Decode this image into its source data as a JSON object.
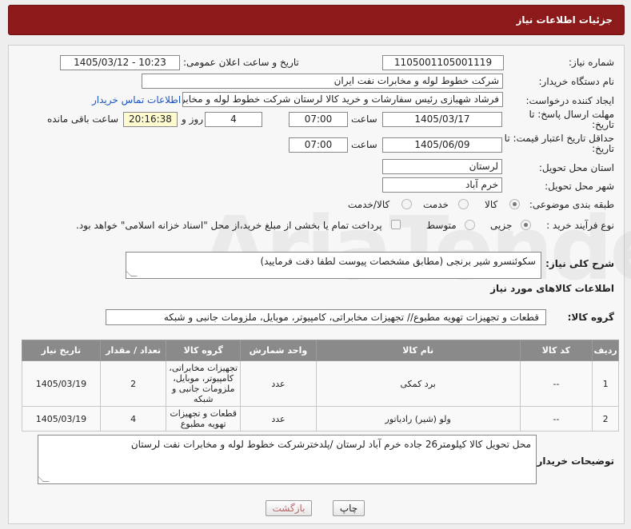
{
  "header": {
    "title": "جزئیات اطلاعات نیاز"
  },
  "form": {
    "need_number": {
      "label": "شماره نیاز:",
      "value": "1105001105001119"
    },
    "announce_datetime": {
      "label": "تاریخ و ساعت اعلان عمومی:",
      "value": "1405/03/12 - 10:23"
    },
    "buyer_org": {
      "label": "نام دستگاه خریدار:",
      "value": "شرکت خطوط لوله و مخابرات نفت ایران"
    },
    "requester": {
      "label": "ایجاد کننده درخواست:",
      "value": "فرشاد شهبازی رئیس سفارشات و خرید کالا لرستان شرکت خطوط لوله و مخابرات",
      "contact_link": "اطلاعات تماس خریدار"
    },
    "reply_deadline": {
      "label": "مهلت ارسال پاسخ: تا تاریخ:",
      "date": "1405/03/17",
      "time_label": "ساعت",
      "time": "07:00",
      "days": "4",
      "days_label": "روز و",
      "remaining": "20:16:38",
      "remaining_label": "ساعت باقی مانده"
    },
    "price_validity": {
      "label": "حداقل تاریخ اعتبار قیمت: تا تاریخ:",
      "date": "1405/06/09",
      "time_label": "ساعت",
      "time": "07:00"
    },
    "province": {
      "label": "استان محل تحویل:",
      "value": "لرستان"
    },
    "city": {
      "label": "شهر محل تحویل:",
      "value": "خرم آباد"
    },
    "category": {
      "label": "طبقه بندی موضوعی:",
      "options": [
        "کالا",
        "خدمت",
        "کالا/خدمت"
      ],
      "selected": "کالا"
    },
    "purchase_type": {
      "label": "نوع فرآیند خرید :",
      "options": [
        "جزیی",
        "متوسط"
      ],
      "selected": "جزیی",
      "payment_note": "پرداخت تمام یا بخشی از مبلغ خرید،از محل \"اسناد خزانه اسلامی\" خواهد بود."
    }
  },
  "summary": {
    "label": "شرح کلی نیاز:",
    "value": "سکوئنسرو شیر برنجی (مطابق مشخصات پیوست لطفا دقت فرمایید)"
  },
  "goods_section": {
    "title": "اطلاعات کالاهای مورد نیاز"
  },
  "goods_group": {
    "label": "گروه کالا:",
    "value": "قطعات و تجهیزات تهویه مطبوع// تجهیزات مخابراتی، کامپیوتر، موبایل، ملزومات جانبی و شبکه"
  },
  "table": {
    "columns": [
      "ردیف",
      "کد کالا",
      "نام کالا",
      "واحد شمارش",
      "گروه کالا",
      "تعداد / مقدار",
      "تاریخ نیاز"
    ],
    "rows": [
      {
        "row": "1",
        "code": "--",
        "name": "برد کمکی",
        "unit": "عدد",
        "group": "تجهیزات مخابراتی، کامپیوتر، موبایل، ملزومات جانبی و شبکه",
        "qty": "2",
        "date": "1405/03/19"
      },
      {
        "row": "2",
        "code": "--",
        "name": "ولو (شیر) رادیاتور",
        "unit": "عدد",
        "group": "قطعات و تجهیزات تهویه مطبوع",
        "qty": "4",
        "date": "1405/03/19"
      }
    ]
  },
  "buyer_notes": {
    "label": "توضیحات خریدار:",
    "value": "محل تحویل کالا کیلومتر26 جاده خرم آباد لرستان /پلدخترشرکت خطوط لوله و مخابرات نفت لرستان"
  },
  "buttons": {
    "print": "چاپ",
    "back": "بازگشت"
  },
  "watermark": "AriaTender.net"
}
